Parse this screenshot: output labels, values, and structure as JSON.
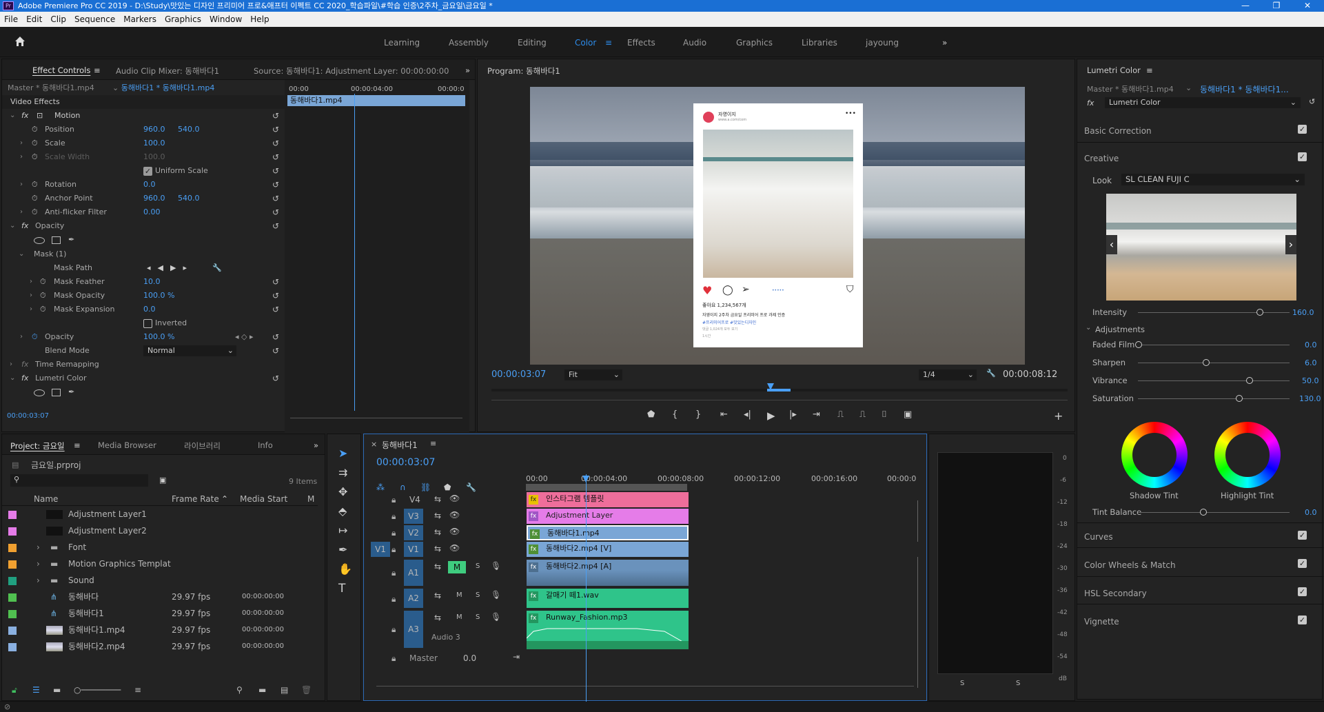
{
  "window": {
    "title": "Adobe Premiere Pro CC 2019 - D:\\Study\\맛있는 디자인 프리미어 프로&애프터 이펙트 CC 2020_학습파일\\#학습 인증\\2주차_금요일\\금요일 *",
    "app_icon": "Pr",
    "min": "—",
    "max": "❐",
    "close": "✕"
  },
  "menu": [
    "File",
    "Edit",
    "Clip",
    "Sequence",
    "Markers",
    "Graphics",
    "Window",
    "Help"
  ],
  "workspaces": [
    "Learning",
    "Assembly",
    "Editing",
    "Color",
    "Effects",
    "Audio",
    "Graphics",
    "Libraries",
    "jayoung"
  ],
  "active_workspace": "Color",
  "effect_controls": {
    "tabs": [
      "Effect Controls",
      "Audio Clip Mixer: 동해바다1",
      "Source: 동해바다1: Adjustment Layer: 00:00:00:00"
    ],
    "master": "Master * 동해바다1.mp4",
    "clip": "동해바다1 * 동해바다1.mp4",
    "ruler": [
      "00:00",
      "00:00:04:00",
      "00:00:0"
    ],
    "clip_bar": "동해바다1.mp4",
    "video_effects": "Video Effects",
    "motion": "Motion",
    "position_label": "Position",
    "position_x": "960.0",
    "position_y": "540.0",
    "scale_label": "Scale",
    "scale": "100.0",
    "scale_width_label": "Scale Width",
    "scale_width": "100.0",
    "uniform_scale": "Uniform Scale",
    "rotation_label": "Rotation",
    "rotation": "0.0",
    "anchor_label": "Anchor Point",
    "anchor_x": "960.0",
    "anchor_y": "540.0",
    "antiflicker_label": "Anti-flicker Filter",
    "antiflicker": "0.00",
    "opacity_section": "Opacity",
    "mask": "Mask (1)",
    "mask_path": "Mask Path",
    "mask_feather_label": "Mask Feather",
    "mask_feather": "10.0",
    "mask_opacity_label": "Mask Opacity",
    "mask_opacity": "100.0 %",
    "mask_expansion_label": "Mask Expansion",
    "mask_expansion": "0.0",
    "inverted": "Inverted",
    "opacity_label": "Opacity",
    "opacity": "100.0 %",
    "blend_label": "Blend Mode",
    "blend": "Normal",
    "time_remap": "Time Remapping",
    "lumetri": "Lumetri Color",
    "timecode": "00:00:03:07"
  },
  "program": {
    "title": "Program: 동해바다1",
    "timecode": "00:00:03:07",
    "fit": "Fit",
    "resolution": "1/4",
    "duration": "00:00:08:12",
    "insta": {
      "user": "자영이지",
      "sub": "www.a.com/com",
      "likes": "좋아요 1,234,567개",
      "caption": "자영이지 2주차 금요일 프리미어 프로 과제 인증",
      "tags": "#프리미어프로 #맛있는디자인",
      "comments": "댓글 1,024개 모두 보기",
      "time": "1시간"
    }
  },
  "lumetri": {
    "title": "Lumetri Color",
    "master": "Master * 동해바다1.mp4",
    "clip": "동해바다1 * 동해바다1...",
    "effect": "Lumetri Color",
    "basic": "Basic Correction",
    "creative": "Creative",
    "look_label": "Look",
    "look": "SL CLEAN FUJI C",
    "intensity_label": "Intensity",
    "intensity": "160.0",
    "adjustments": "Adjustments",
    "faded_label": "Faded Film",
    "faded": "0.0",
    "sharpen_label": "Sharpen",
    "sharpen": "6.0",
    "vibrance_label": "Vibrance",
    "vibrance": "50.0",
    "saturation_label": "Saturation",
    "saturation": "130.0",
    "shadow_tint": "Shadow Tint",
    "highlight_tint": "Highlight Tint",
    "tint_balance_label": "Tint Balance",
    "tint_balance": "0.0",
    "curves": "Curves",
    "color_wheels": "Color Wheels & Match",
    "hsl": "HSL Secondary",
    "vignette": "Vignette"
  },
  "project": {
    "tabs": [
      "Project: 금요일",
      "Media Browser",
      "라이브러리",
      "Info"
    ],
    "file": "금요일.prproj",
    "items_count": "9 Items",
    "columns": [
      "Name",
      "Frame Rate",
      "Media Start",
      "M"
    ],
    "items": [
      {
        "name": "Adjustment Layer1",
        "rate": "",
        "start": "",
        "color": "#e57ce8"
      },
      {
        "name": "Adjustment Layer2",
        "rate": "",
        "start": "",
        "color": "#e57ce8"
      },
      {
        "name": "Font",
        "rate": "",
        "start": "",
        "color": "#f0a030"
      },
      {
        "name": "Motion Graphics Templat",
        "rate": "",
        "start": "",
        "color": "#f0a030"
      },
      {
        "name": "Sound",
        "rate": "",
        "start": "",
        "color": "#20a080"
      },
      {
        "name": "동해바다",
        "rate": "29.97 fps",
        "start": "00:00:00:00",
        "color": "#50c050"
      },
      {
        "name": "동해바다1",
        "rate": "29.97 fps",
        "start": "00:00:00:00",
        "color": "#50c050"
      },
      {
        "name": "동해바다1.mp4",
        "rate": "29.97 fps",
        "start": "00:00:00:00",
        "color": "#8ab0e0"
      },
      {
        "name": "동해바다2.mp4",
        "rate": "29.97 fps",
        "start": "00:00:00:00",
        "color": "#8ab0e0"
      }
    ]
  },
  "timeline": {
    "title": "동해바다1",
    "timecode": "00:00:03:07",
    "ruler": [
      "00:00",
      "00:00:04:00",
      "00:00:08:00",
      "00:00:12:00",
      "00:00:16:00",
      "00:00:0"
    ],
    "tracks": {
      "v4": "V4",
      "v3": "V3",
      "v2": "V2",
      "v1": "V1",
      "src_v1": "V1",
      "a1": "A1",
      "a2": "A2",
      "a3": "A3",
      "audio3": "Audio 3",
      "master": "Master",
      "master_val": "0.0"
    },
    "clips": {
      "v4": "인스타그램 템플릿",
      "v3": "Adjustment Layer",
      "v2": "동해바다1.mp4",
      "v1": "동해바다2.mp4 [V]",
      "a1": "동해바다2.mp4 [A]",
      "a2": "갈매기 떼1.wav",
      "a3": "Runway_Fashion.mp3"
    },
    "track_btns": {
      "m": "M",
      "s": "S"
    }
  },
  "meter": {
    "scale": [
      "0",
      "-6",
      "-12",
      "-18",
      "-24",
      "-30",
      "-36",
      "-42",
      "-48",
      "-54",
      "dB"
    ],
    "solo": [
      "S",
      "S"
    ]
  }
}
